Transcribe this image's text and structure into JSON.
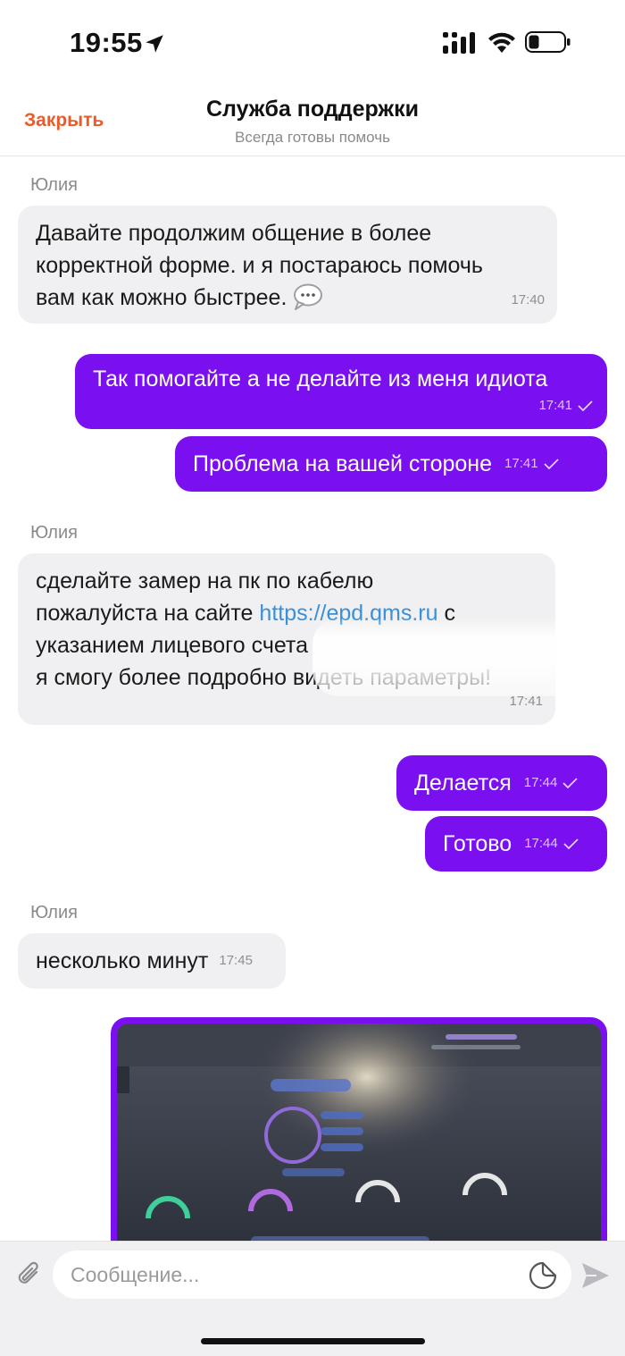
{
  "status_bar": {
    "time": "19:55",
    "icons": [
      "location-arrow-icon",
      "cellular-signal-icon",
      "wifi-icon",
      "battery-icon"
    ]
  },
  "header": {
    "close_label": "Закрыть",
    "title": "Служба поддержки",
    "subtitle": "Всегда готовы помочь"
  },
  "messages": [
    {
      "sender": "Юлия",
      "direction": "in",
      "text_parts": [
        "Давайте продолжим общение в более",
        "корректной форме. и я постараюсь помочь",
        "вам как можно быстрее."
      ],
      "time": "17:40"
    },
    {
      "direction": "out",
      "text": "Так помогайте а не делайте из меня идиота",
      "time": "17:41"
    },
    {
      "direction": "out",
      "text": "Проблема на вашей стороне",
      "time": "17:41"
    },
    {
      "sender": "Юлия",
      "direction": "in",
      "text_parts": [
        "сделайте замер на пк по кабелю",
        "пожалуйста на сайте",
        "https://epd.qms.ru",
        "с",
        "указанием лицевого счета",
        "я смогу более подробно видеть параметры!"
      ],
      "time": "17:41"
    },
    {
      "direction": "out",
      "text": "Делается",
      "time": "17:44"
    },
    {
      "direction": "out",
      "text": "Готово",
      "time": "17:44"
    },
    {
      "sender": "Юлия",
      "direction": "in",
      "text": "несколько минут",
      "time": "17:45"
    },
    {
      "direction": "out",
      "type": "image"
    }
  ],
  "input": {
    "placeholder": "Сообщение..."
  },
  "colors": {
    "accent_purple": "#7a0ff0",
    "close_orange": "#ea5a2a",
    "incoming_bubble": "#f0f0f2",
    "link": "#3a8fd6"
  }
}
